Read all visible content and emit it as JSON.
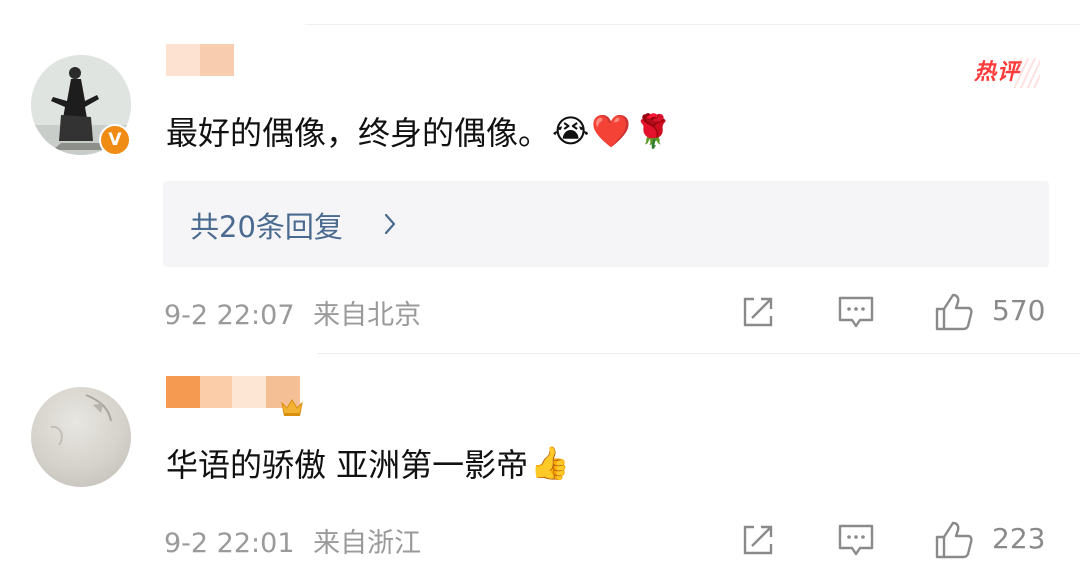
{
  "comments": [
    {
      "text": "最好的偶像，终身的偶像。",
      "emojis": [
        "😭",
        "❤️",
        "🌹"
      ],
      "badge": "V",
      "hot_label": "热评",
      "replies_label": "共20条回复",
      "time": "9-2 22:07",
      "location": "来自北京",
      "likes": "570"
    },
    {
      "text": "华语的骄傲 亚洲第一影帝",
      "emojis": [
        "👍"
      ],
      "time": "9-2 22:01",
      "location": "来自浙江",
      "likes": "223"
    }
  ],
  "colors": {
    "link": "#4a6a8f",
    "meta": "#9a9a9a",
    "hot": "#ff3b3b",
    "verified": "#f08c13"
  },
  "icons": [
    "share-icon",
    "reply-icon",
    "like-icon",
    "chevron-right-icon",
    "crown-icon"
  ]
}
